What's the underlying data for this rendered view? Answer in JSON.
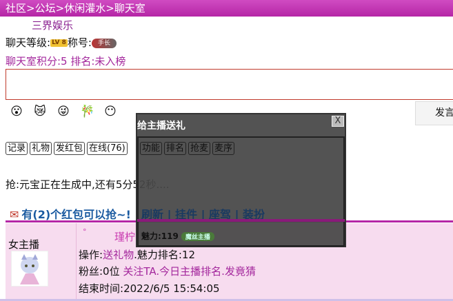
{
  "breadcrumb": {
    "items": [
      "社区",
      "公坛",
      "休闲灌水",
      "聊天室"
    ],
    "sep": ">"
  },
  "subtitle": "三界娱乐",
  "level": {
    "label": "聊天等级:",
    "lv": "LV 8",
    "title_label": "称号:",
    "title_badge": "手长"
  },
  "score": "聊天室积分:5 排名:未入榜",
  "send_label": "发言",
  "emojis": [
    "😮",
    "😿",
    "😜",
    "🎋",
    "😶"
  ],
  "buttons": [
    "记录",
    "礼物",
    "发红包",
    "在线(76)",
    "功能",
    "排名",
    "抢麦",
    "麦序"
  ],
  "status": "抢:元宝正在生成中,还有5分52秒....",
  "packet": {
    "text": "有(2)个红包可以抢~!",
    "links": [
      "刷新",
      "挂件",
      "座驾",
      "装扮"
    ],
    "sep": " | "
  },
  "card": {
    "anchor": "女主播",
    "dot": "°",
    "name": "瑾柠",
    "charm": "魅力:119",
    "charm_tag": "魔丝主播",
    "op_label": "操作:",
    "op_links": [
      "送礼物",
      "魅力排名:12"
    ],
    "fans_label": "粉丝:0位 ",
    "fans_links": [
      "关注TA",
      "今日主播排名",
      "发竟猜"
    ],
    "end_label": "结束时间:",
    "end_time": "2022/6/5 15:54:05"
  },
  "modal": {
    "title": "给主播送礼",
    "close": "X"
  }
}
